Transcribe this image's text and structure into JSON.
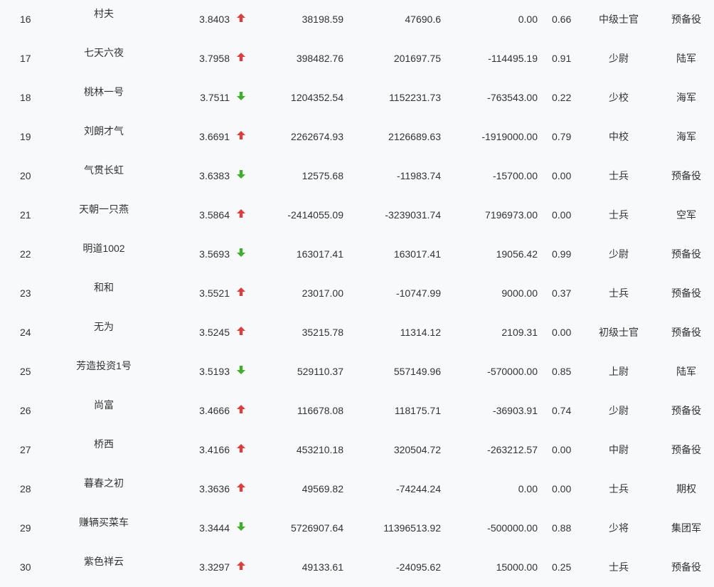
{
  "colors": {
    "up": "#e03c3c",
    "down": "#3fae2a",
    "background": "#f7f9fb",
    "text": "#333333"
  },
  "rows": [
    {
      "rank": "16",
      "name": "村夫",
      "index": "3.8403",
      "trend": "up",
      "v1": "38198.59",
      "v2": "47690.6",
      "v3": "0.00",
      "ratio": "0.66",
      "title": "中级士官",
      "army": "预备役"
    },
    {
      "rank": "17",
      "name": "七天六夜",
      "index": "3.7958",
      "trend": "up",
      "v1": "398482.76",
      "v2": "201697.75",
      "v3": "-114495.19",
      "ratio": "0.91",
      "title": "少尉",
      "army": "陆军"
    },
    {
      "rank": "18",
      "name": "桃林一号",
      "index": "3.7511",
      "trend": "down",
      "v1": "1204352.54",
      "v2": "1152231.73",
      "v3": "-763543.00",
      "ratio": "0.22",
      "title": "少校",
      "army": "海军"
    },
    {
      "rank": "19",
      "name": "刘朗才气",
      "index": "3.6691",
      "trend": "up",
      "v1": "2262674.93",
      "v2": "2126689.63",
      "v3": "-1919000.00",
      "ratio": "0.79",
      "title": "中校",
      "army": "海军"
    },
    {
      "rank": "20",
      "name": "气贯长虹",
      "index": "3.6383",
      "trend": "down",
      "v1": "12575.68",
      "v2": "-11983.74",
      "v3": "-15700.00",
      "ratio": "0.00",
      "title": "士兵",
      "army": "预备役"
    },
    {
      "rank": "21",
      "name": "天朝一只燕",
      "index": "3.5864",
      "trend": "up",
      "v1": "-2414055.09",
      "v2": "-3239031.74",
      "v3": "7196973.00",
      "ratio": "0.00",
      "title": "士兵",
      "army": "空军"
    },
    {
      "rank": "22",
      "name": "明道1002",
      "index": "3.5693",
      "trend": "down",
      "v1": "163017.41",
      "v2": "163017.41",
      "v3": "19056.42",
      "ratio": "0.99",
      "title": "少尉",
      "army": "预备役"
    },
    {
      "rank": "23",
      "name": "和和",
      "index": "3.5521",
      "trend": "up",
      "v1": "23017.00",
      "v2": "-10747.99",
      "v3": "9000.00",
      "ratio": "0.37",
      "title": "士兵",
      "army": "预备役"
    },
    {
      "rank": "24",
      "name": "无为",
      "index": "3.5245",
      "trend": "up",
      "v1": "35215.78",
      "v2": "11314.12",
      "v3": "2109.31",
      "ratio": "0.00",
      "title": "初级士官",
      "army": "预备役"
    },
    {
      "rank": "25",
      "name": "芳造投资1号",
      "index": "3.5193",
      "trend": "down",
      "v1": "529110.37",
      "v2": "557149.96",
      "v3": "-570000.00",
      "ratio": "0.85",
      "title": "上尉",
      "army": "陆军"
    },
    {
      "rank": "26",
      "name": "尚富",
      "index": "3.4666",
      "trend": "up",
      "v1": "116678.08",
      "v2": "118175.71",
      "v3": "-36903.91",
      "ratio": "0.74",
      "title": "少尉",
      "army": "预备役"
    },
    {
      "rank": "27",
      "name": "桥西",
      "index": "3.4166",
      "trend": "up",
      "v1": "453210.18",
      "v2": "320504.72",
      "v3": "-263212.57",
      "ratio": "0.00",
      "title": "中尉",
      "army": "预备役"
    },
    {
      "rank": "28",
      "name": "暮春之初",
      "index": "3.3636",
      "trend": "up",
      "v1": "49569.82",
      "v2": "-74244.24",
      "v3": "0.00",
      "ratio": "0.00",
      "title": "士兵",
      "army": "期权"
    },
    {
      "rank": "29",
      "name": "赚辆买菜车",
      "index": "3.3444",
      "trend": "down",
      "v1": "5726907.64",
      "v2": "11396513.92",
      "v3": "-500000.00",
      "ratio": "0.88",
      "title": "少将",
      "army": "集团军"
    },
    {
      "rank": "30",
      "name": "紫色祥云",
      "index": "3.3297",
      "trend": "up",
      "v1": "49133.61",
      "v2": "-24095.62",
      "v3": "15000.00",
      "ratio": "0.25",
      "title": "士兵",
      "army": "预备役"
    }
  ]
}
